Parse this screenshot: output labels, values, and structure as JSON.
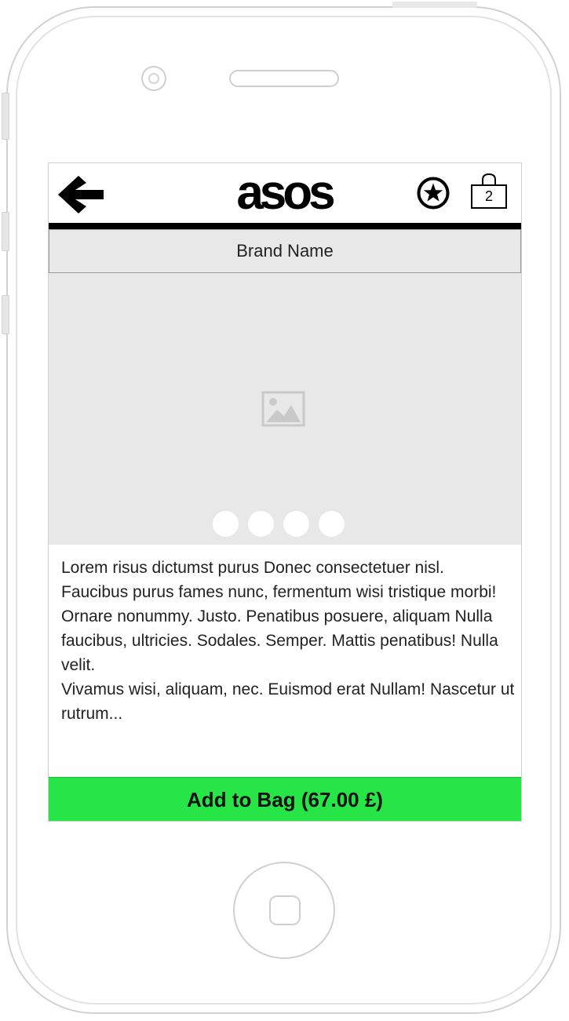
{
  "header": {
    "logo_text": "asos",
    "back_icon": "arrow-left-icon",
    "favorite_icon": "star-circle-icon",
    "bag_icon": "shopping-bag-icon",
    "bag_count": "2"
  },
  "brand": {
    "name": "Brand Name"
  },
  "gallery": {
    "placeholder_icon": "image-placeholder-icon",
    "dot_count": 4
  },
  "product": {
    "description": "Lorem risus dictumst purus Donec consectetuer nisl. Faucibus purus fames nunc, fermentum wisi tristique morbi! Ornare nonummy. Justo. Penatibus posuere, aliquam Nulla faucibus, ultricies. Sodales. Semper. Mattis penatibus! Nulla velit.\nVivamus wisi, aliquam, nec. Euismod erat Nullam! Nascetur ut rutrum..."
  },
  "actions": {
    "add_to_bag_label": "Add to Bag (67.00 £)"
  },
  "colors": {
    "add_to_bag_bg": "#27e546",
    "header_rule": "#000000",
    "panel_bg": "#e8e8e8"
  }
}
